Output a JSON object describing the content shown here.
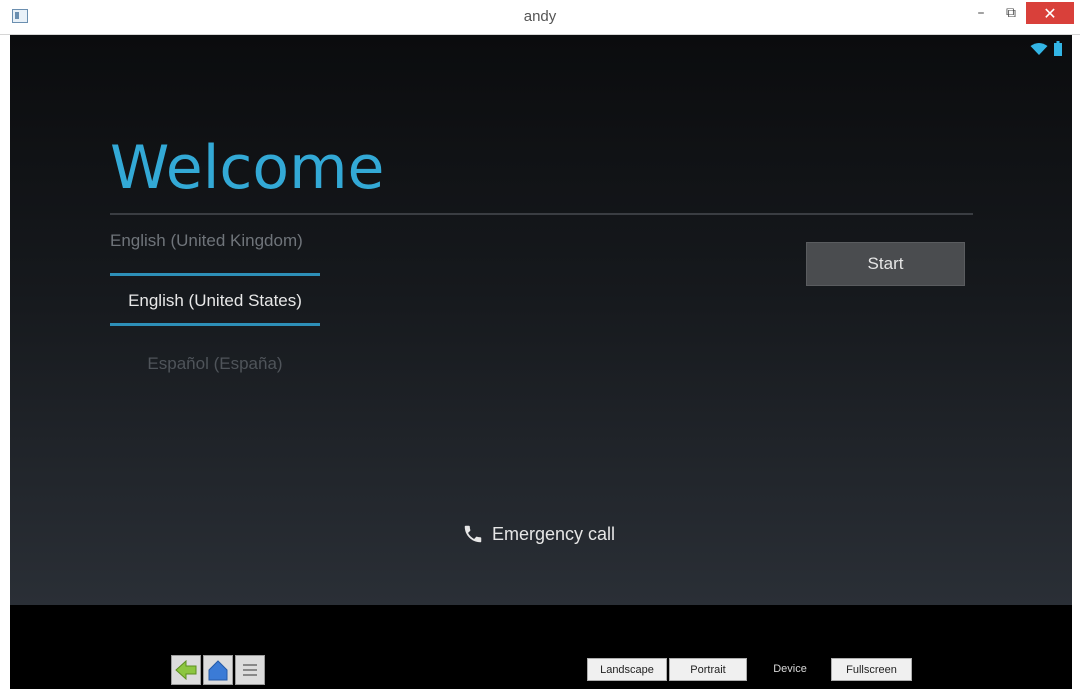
{
  "window": {
    "title": "andy",
    "minimize_glyph": "–",
    "maximize_glyph": "⧉",
    "close_glyph": "✕"
  },
  "status_bar": {
    "icons": [
      "wifi-icon",
      "battery-icon"
    ],
    "icon_color": "#33b5e5"
  },
  "welcome": {
    "title": "Welcome",
    "title_color": "#33a9d6"
  },
  "languages": {
    "items": [
      "English (United Kingdom)",
      "English (United States)",
      "Español (España)"
    ],
    "selected": "English (United States)",
    "accent_color": "#2d8fb8"
  },
  "start_button": {
    "label": "Start"
  },
  "emergency": {
    "label": "Emergency call",
    "icon": "phone-icon"
  },
  "bottom_bar": {
    "nav_icons": [
      "back-arrow-icon",
      "home-icon",
      "menu-icon"
    ],
    "landscape_label": "Landscape",
    "portrait_label": "Portrait",
    "device_label": "Device",
    "fullscreen_label": "Fullscreen"
  }
}
